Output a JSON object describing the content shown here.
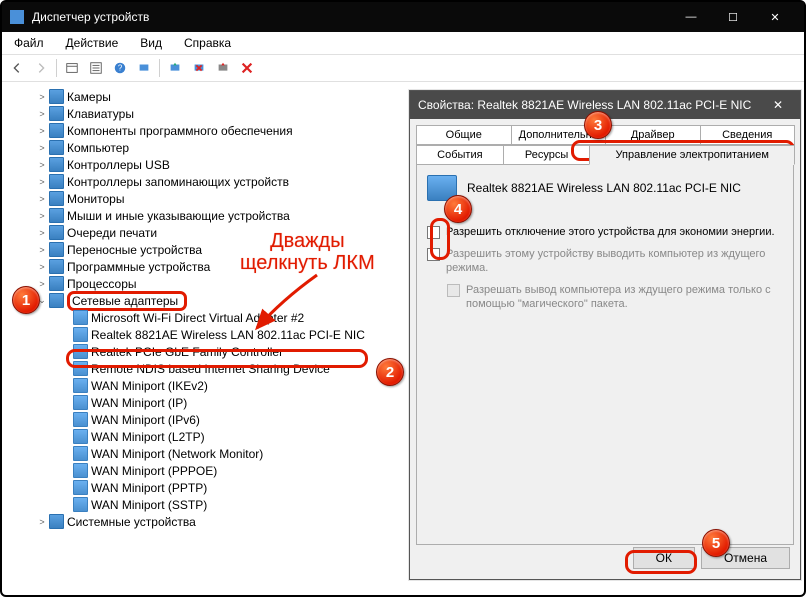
{
  "window": {
    "title": "Диспетчер устройств",
    "minimize": "—",
    "maximize": "☐",
    "close": "✕"
  },
  "menu": {
    "file": "Файл",
    "action": "Действие",
    "view": "Вид",
    "help": "Справка"
  },
  "tree": {
    "items": [
      {
        "label": "Камеры"
      },
      {
        "label": "Клавиатуры"
      },
      {
        "label": "Компоненты программного обеспечения"
      },
      {
        "label": "Компьютер"
      },
      {
        "label": "Контроллеры USB"
      },
      {
        "label": "Контроллеры запоминающих устройств"
      },
      {
        "label": "Мониторы"
      },
      {
        "label": "Мыши и иные указывающие устройства"
      },
      {
        "label": "Очереди печати"
      },
      {
        "label": "Переносные устройства"
      },
      {
        "label": "Программные устройства"
      },
      {
        "label": "Процессоры"
      }
    ],
    "network": {
      "label": "Сетевые адаптеры",
      "children": [
        "Microsoft Wi-Fi Direct Virtual Adapter #2",
        "Realtek 8821AE Wireless LAN 802.11ac PCI-E NIC",
        "Realtek PCIe GbE Family Controller",
        "Remote NDIS based Internet Sharing Device",
        "WAN Miniport (IKEv2)",
        "WAN Miniport (IP)",
        "WAN Miniport (IPv6)",
        "WAN Miniport (L2TP)",
        "WAN Miniport (Network Monitor)",
        "WAN Miniport (PPPOE)",
        "WAN Miniport (PPTP)",
        "WAN Miniport (SSTP)"
      ]
    },
    "last": {
      "label": "Системные устройства"
    }
  },
  "annot": {
    "text1": "Дважды",
    "text2": "щелкнуть ЛКМ"
  },
  "dialog": {
    "title": "Свойства: Realtek 8821AE Wireless LAN 802.11ac PCI-E NIC",
    "tabs": {
      "row1": [
        "Общие",
        "Дополнительно",
        "Драйвер",
        "Сведения"
      ],
      "row2": [
        "События",
        "Ресурсы",
        "Управление электропитанием"
      ]
    },
    "device": "Realtek 8821AE Wireless LAN 802.11ac PCI-E NIC",
    "chk1": "Разрешить отключение этого устройства для экономии энергии.",
    "chk2": "Разрешить этому устройству выводить компьютер из ждущего режима.",
    "chk3": "Разрешать вывод компьютера из ждущего режима только с помощью \"магического\" пакета.",
    "ok": "ОК",
    "cancel": "Отмена"
  },
  "badges": {
    "b1": "1",
    "b2": "2",
    "b3": "3",
    "b4": "4",
    "b5": "5"
  }
}
